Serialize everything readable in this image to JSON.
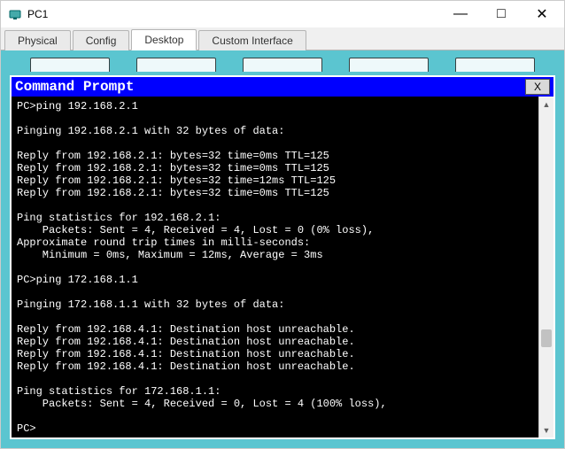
{
  "window": {
    "title": "PC1",
    "controls": {
      "min": "—",
      "max": "□",
      "close": "✕"
    }
  },
  "tabs": [
    {
      "label": "Physical",
      "active": false
    },
    {
      "label": "Config",
      "active": false
    },
    {
      "label": "Desktop",
      "active": true
    },
    {
      "label": "Custom Interface",
      "active": false
    }
  ],
  "cmd": {
    "title": "Command Prompt",
    "close": "X",
    "lines": [
      "PC>ping 192.168.2.1",
      "",
      "Pinging 192.168.2.1 with 32 bytes of data:",
      "",
      "Reply from 192.168.2.1: bytes=32 time=0ms TTL=125",
      "Reply from 192.168.2.1: bytes=32 time=0ms TTL=125",
      "Reply from 192.168.2.1: bytes=32 time=12ms TTL=125",
      "Reply from 192.168.2.1: bytes=32 time=0ms TTL=125",
      "",
      "Ping statistics for 192.168.2.1:",
      "    Packets: Sent = 4, Received = 4, Lost = 0 (0% loss),",
      "Approximate round trip times in milli-seconds:",
      "    Minimum = 0ms, Maximum = 12ms, Average = 3ms",
      "",
      "PC>ping 172.168.1.1",
      "",
      "Pinging 172.168.1.1 with 32 bytes of data:",
      "",
      "Reply from 192.168.4.1: Destination host unreachable.",
      "Reply from 192.168.4.1: Destination host unreachable.",
      "Reply from 192.168.4.1: Destination host unreachable.",
      "Reply from 192.168.4.1: Destination host unreachable.",
      "",
      "Ping statistics for 172.168.1.1:",
      "    Packets: Sent = 4, Received = 0, Lost = 4 (100% loss),",
      "",
      "PC>"
    ]
  },
  "scroll": {
    "up": "▲",
    "down": "▼"
  }
}
